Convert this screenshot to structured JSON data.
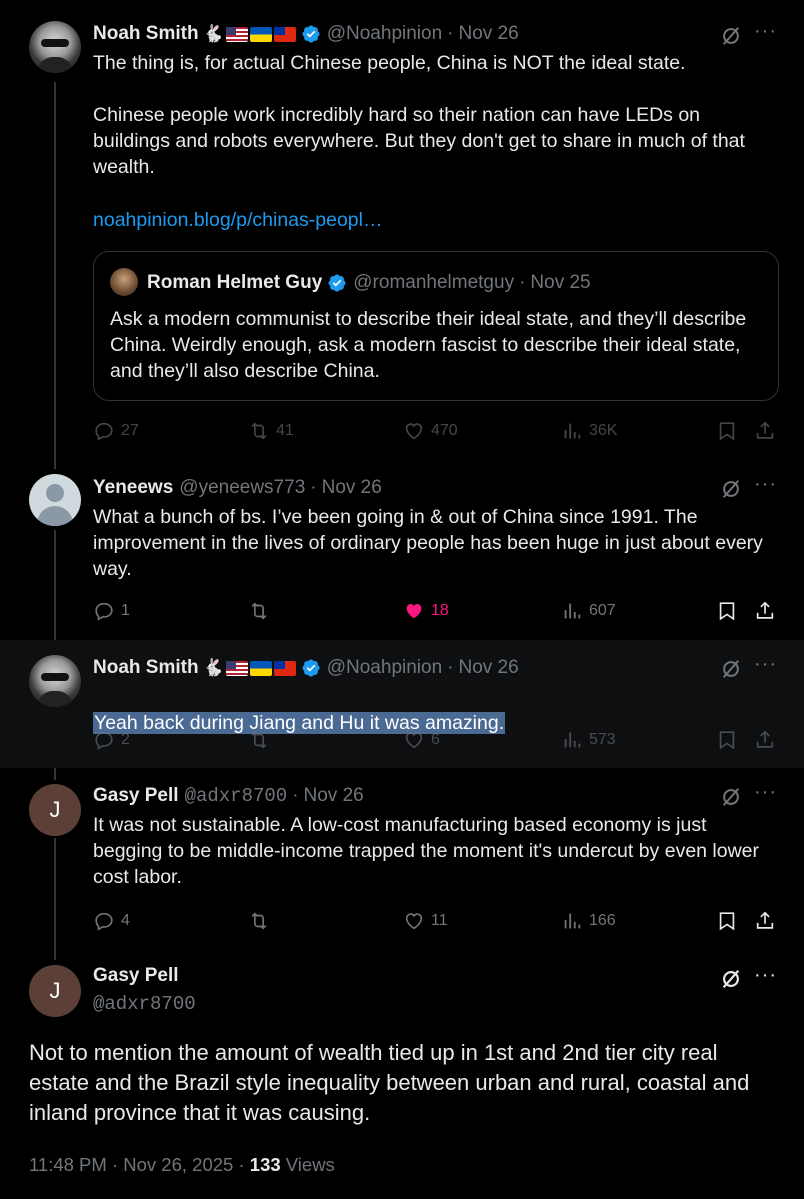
{
  "tweets": [
    {
      "name": "Noah Smith",
      "handle": "@Noahpinion",
      "date": "Nov 26",
      "text": "The thing is, for actual Chinese people, China is NOT the ideal state.\n\nChinese people work incredibly hard so their nation can have LEDs on buildings and robots everywhere. But they don't get to share in much of that wealth.",
      "link": "noahpinion.blog/p/chinas-peopl…",
      "quote": {
        "name": "Roman Helmet Guy",
        "handle": "@romanhelmetguy",
        "date": "Nov 25",
        "text": "Ask a modern communist to describe their ideal state, and they’ll describe China. Weirdly enough, ask a modern fascist to describe their ideal state, and they’ll also describe China."
      },
      "replies": "27",
      "reposts": "41",
      "likes": "470",
      "views": "36K"
    },
    {
      "name": "Yeneews",
      "handle": "@yeneews773",
      "date": "Nov 26",
      "text": "What a bunch of bs. I’ve been going in & out of China since 1991. The improvement in the lives of ordinary people has been huge in just about every way.",
      "replies": "1",
      "reposts": "",
      "likes": "18",
      "views": "607"
    },
    {
      "name": "Noah Smith",
      "handle": "@Noahpinion",
      "date": "Nov 26",
      "text": "Yeah back during Jiang and Hu it was amazing.",
      "replies": "2",
      "reposts": "",
      "likes": "6",
      "views": "573"
    },
    {
      "name": "Gasy Pell",
      "handle": "@adxr8700",
      "date": "Nov 26",
      "avatar_letter": "J",
      "text": "It was not sustainable. A low-cost manufacturing based economy is just begging to be middle-income trapped the moment it's undercut by even lower cost labor.",
      "replies": "4",
      "reposts": "",
      "likes": "11",
      "views": "166"
    }
  ],
  "main": {
    "name": "Gasy Pell",
    "handle": "@adxr8700",
    "avatar_letter": "J",
    "text": "Not to mention the amount of wealth tied up in 1st and 2nd tier city real estate and the Brazil style inequality between urban and rural, coastal and inland province that it was causing.",
    "time": "11:48 PM",
    "date": "Nov 26, 2025",
    "views_count": "133",
    "views_label": "Views"
  },
  "dot": "·",
  "colors": {
    "accent": "#1d9bf0",
    "like": "#f91880",
    "muted": "#71767b",
    "selection": "#4a6a93"
  }
}
